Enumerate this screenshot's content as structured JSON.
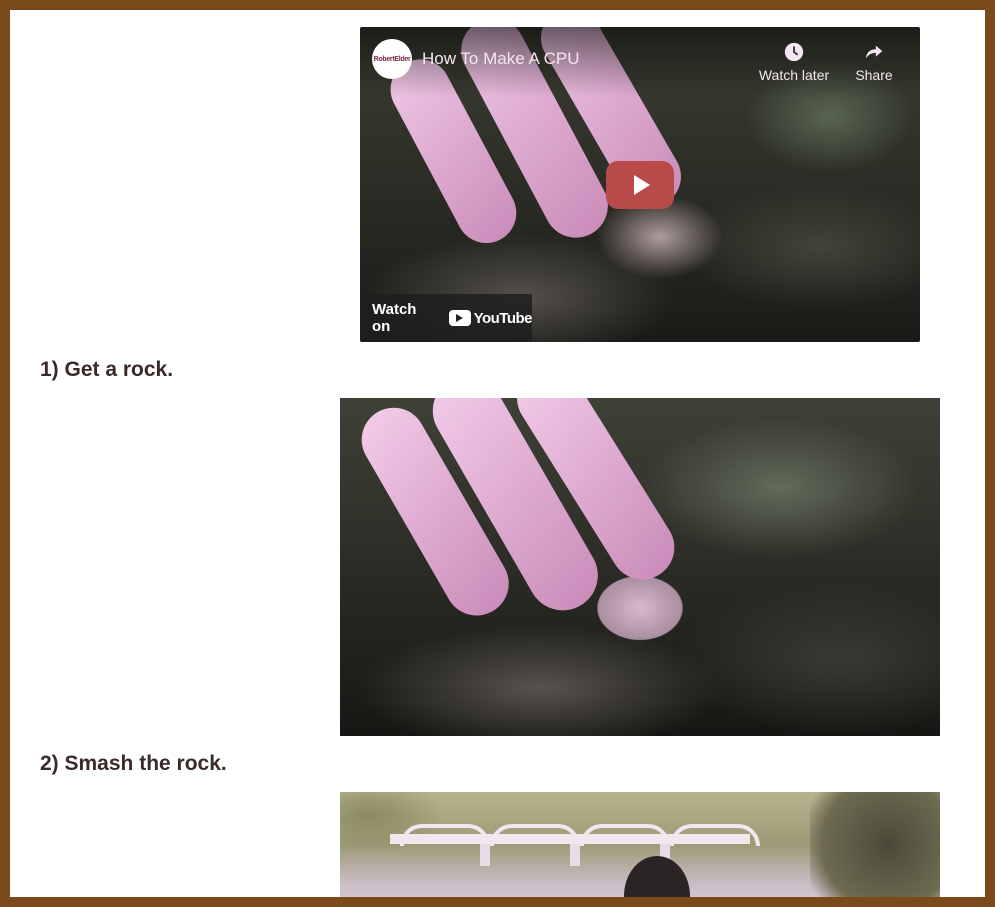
{
  "video": {
    "channel_logo_text": "RobertElder",
    "title": "How To Make A CPU",
    "watch_later_label": "Watch later",
    "share_label": "Share",
    "watch_on_label": "Watch on",
    "youtube_label": "YouTube"
  },
  "steps": [
    {
      "label": "1) Get a rock."
    },
    {
      "label": "2) Smash the rock."
    }
  ],
  "colors": {
    "frame": "#7a4a1a",
    "page_background": "#ffffff",
    "heading_text": "#3b2a2a",
    "play_button": "#b84a4a"
  }
}
